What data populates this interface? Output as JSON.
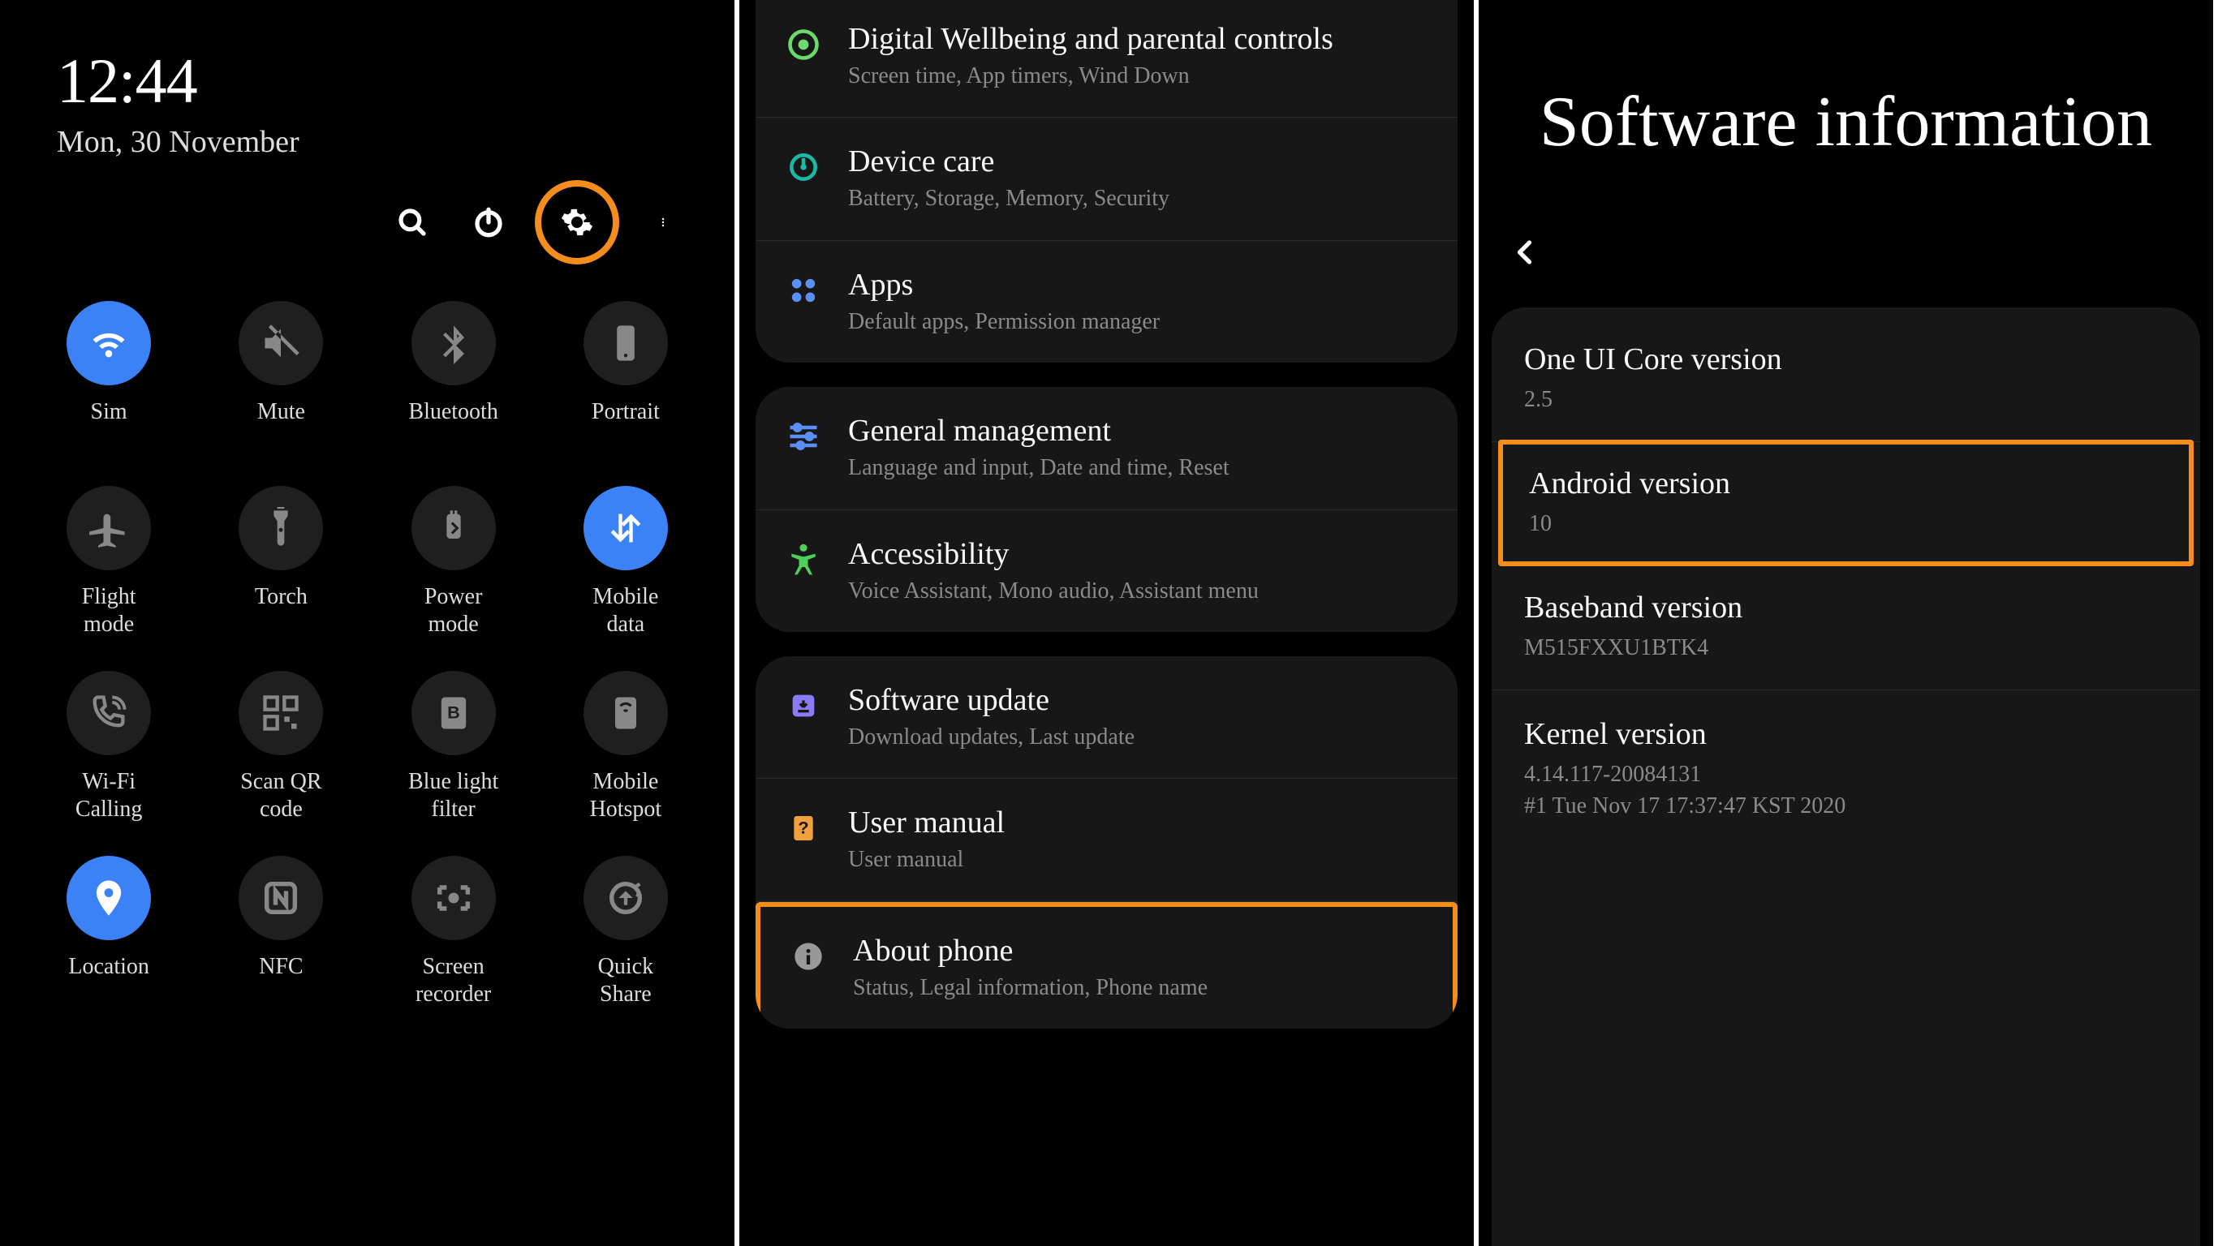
{
  "panel1": {
    "time": "12:44",
    "date": "Mon, 30 November",
    "tiles": [
      {
        "name": "wifi",
        "label": "Sim",
        "active": true
      },
      {
        "name": "mute",
        "label": "Mute",
        "active": false
      },
      {
        "name": "bluetooth",
        "label": "Bluetooth",
        "active": false
      },
      {
        "name": "portrait",
        "label": "Portrait",
        "active": false
      },
      {
        "name": "flight",
        "label": "Flight\nmode",
        "active": false
      },
      {
        "name": "torch",
        "label": "Torch",
        "active": false
      },
      {
        "name": "power",
        "label": "Power\nmode",
        "active": false
      },
      {
        "name": "mobiledata",
        "label": "Mobile\ndata",
        "active": true
      },
      {
        "name": "wificalling",
        "label": "Wi-Fi\nCalling",
        "active": false
      },
      {
        "name": "scanqr",
        "label": "Scan QR\ncode",
        "active": false
      },
      {
        "name": "bluelight",
        "label": "Blue light\nfilter",
        "active": false
      },
      {
        "name": "hotspot",
        "label": "Mobile\nHotspot",
        "active": false
      },
      {
        "name": "location",
        "label": "Location",
        "active": true
      },
      {
        "name": "nfc",
        "label": "NFC",
        "active": false
      },
      {
        "name": "screenrec",
        "label": "Screen\nrecorder",
        "active": false
      },
      {
        "name": "quickshare",
        "label": "Quick\nShare",
        "active": false
      }
    ]
  },
  "panel2": {
    "groups": [
      {
        "rows": [
          {
            "icon": "wellbeing",
            "iconColor": "#6cd96c",
            "title": "Digital Wellbeing and parental controls",
            "sub": "Screen time, App timers, Wind Down"
          },
          {
            "icon": "devicecare",
            "iconColor": "#1bb8a6",
            "title": "Device care",
            "sub": "Battery, Storage, Memory, Security"
          },
          {
            "icon": "apps",
            "iconColor": "#5a8ff3",
            "title": "Apps",
            "sub": "Default apps, Permission manager"
          }
        ]
      },
      {
        "rows": [
          {
            "icon": "general",
            "iconColor": "#5a8ff3",
            "title": "General management",
            "sub": "Language and input, Date and time, Reset"
          },
          {
            "icon": "accessibility",
            "iconColor": "#4dd05a",
            "title": "Accessibility",
            "sub": "Voice Assistant, Mono audio, Assistant menu"
          }
        ]
      },
      {
        "rows": [
          {
            "icon": "swupdate",
            "iconColor": "#8a7af5",
            "title": "Software update",
            "sub": "Download updates, Last update"
          },
          {
            "icon": "usermanual",
            "iconColor": "#f0a03c",
            "title": "User manual",
            "sub": "User manual"
          },
          {
            "icon": "about",
            "iconColor": "#999",
            "title": "About phone",
            "sub": "Status, Legal information, Phone name",
            "highlight": true
          }
        ]
      }
    ]
  },
  "panel3": {
    "title": "Software information",
    "items": [
      {
        "label": "One UI Core version",
        "value": "2.5"
      },
      {
        "label": "Android version",
        "value": "10",
        "highlight": true
      },
      {
        "label": "Baseband version",
        "value": "M515FXXU1BTK4"
      },
      {
        "label": "Kernel version",
        "value": "4.14.117-20084131\n#1 Tue Nov 17 17:37:47 KST 2020"
      }
    ]
  }
}
